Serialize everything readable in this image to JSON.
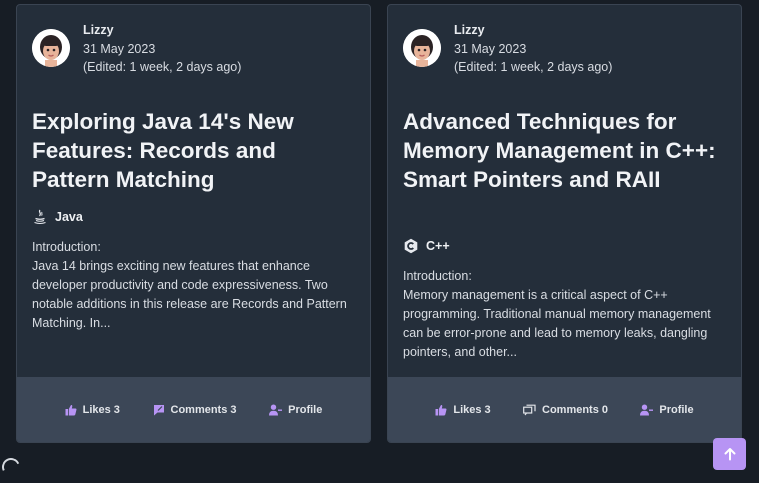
{
  "posts": [
    {
      "author": "Lizzy",
      "date": "31 May 2023",
      "edited": "(Edited: 1 week, 2 days ago)",
      "title": "Exploring Java 14's New Features: Records and Pattern Matching",
      "tag": "Java",
      "tag_icon": "java-icon",
      "excerpt_intro": "Introduction:",
      "excerpt": "Java 14 brings exciting new features that enhance developer productivity and code expressiveness. Two notable additions in this release are Records and Pattern Matching. In...",
      "likes_label": "Likes 3",
      "comments_label": "Comments 3",
      "comments_icon": "comment-filled-icon",
      "profile_label": "Profile"
    },
    {
      "author": "Lizzy",
      "date": "31 May 2023",
      "edited": "(Edited: 1 week, 2 days ago)",
      "title": "Advanced Techniques for Memory Management in C++: Smart Pointers and RAII",
      "tag": "C++",
      "tag_icon": "cpp-icon",
      "excerpt_intro": "Introduction:",
      "excerpt": "Memory management is a critical aspect of C++ programming. Traditional manual memory management can be error-prone and lead to memory leaks, dangling pointers, and other...",
      "likes_label": "Likes 3",
      "comments_label": "Comments 0",
      "comments_icon": "comments-outline-icon",
      "profile_label": "Profile"
    }
  ],
  "colors": {
    "background": "#171d25",
    "card": "#242e3a",
    "card_footer": "#3c4757",
    "accent": "#b794f4"
  }
}
